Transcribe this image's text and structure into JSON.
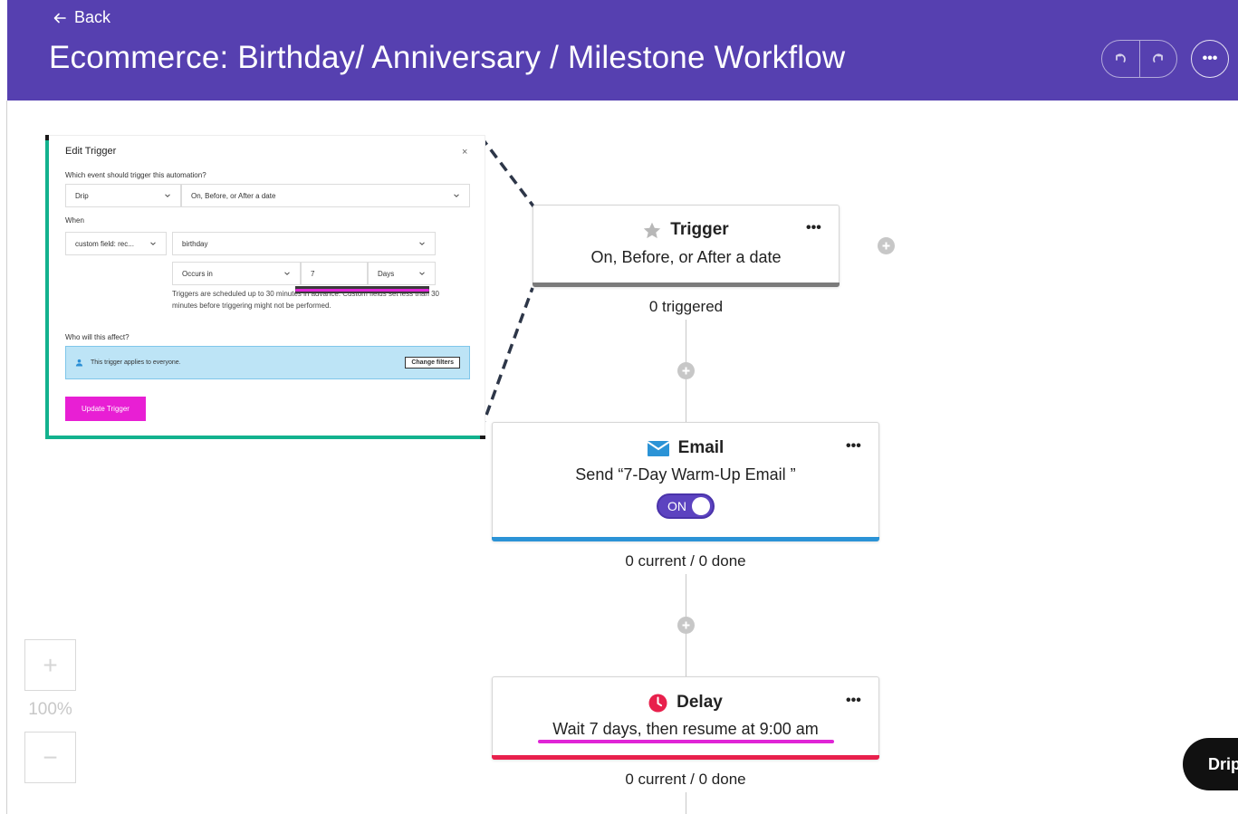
{
  "header": {
    "back_label": "Back",
    "title": "Ecommerce: Birthday/ Anniversary / Milestone Workflow",
    "more_label": "•••"
  },
  "edit_trigger": {
    "title": "Edit Trigger",
    "close": "×",
    "event_question": "Which event should trigger this automation?",
    "provider": "Drip",
    "event": "On, Before, or After a date",
    "when_label": "When",
    "field": "custom field: rec...",
    "field_value": "birthday",
    "timing": "Occurs in",
    "amount": "7",
    "unit": "Days",
    "note": "Triggers are scheduled up to 30 minutes in advance. Custom fields set less than 30 minutes before triggering might not be performed.",
    "affect_question": "Who will this affect?",
    "affect_text": "This trigger applies to everyone.",
    "change_filters": "Change filters",
    "update_button": "Update Trigger"
  },
  "flow": {
    "trigger": {
      "title": "Trigger",
      "subtitle": "On, Before, or After a date",
      "count": "0 triggered",
      "dots": "•••"
    },
    "email": {
      "title": "Email",
      "subtitle": "Send “7-Day Warm-Up Email ”",
      "toggle": "ON",
      "count": "0 current / 0 done",
      "dots": "•••"
    },
    "delay": {
      "title": "Delay",
      "subtitle": "Wait 7 days, then resume at 9:00 am",
      "count": "0 current / 0 done",
      "dots": "•••"
    }
  },
  "zoom": {
    "plus": "+",
    "level": "100%",
    "minus": "−"
  },
  "drip_button": "Drip",
  "colors": {
    "header_bg": "#5640b0",
    "accent_pink": "#e025d6",
    "email_bar": "#2b93d6",
    "delay_bar": "#e8204c",
    "trigger_bar": "#7a7a7a",
    "toggle_bg": "#5c43c0"
  },
  "icons": [
    "back-arrow-icon",
    "undo-icon",
    "redo-icon",
    "more-icon",
    "star-icon",
    "envelope-icon",
    "clock-icon",
    "plus-icon",
    "chevron-down-icon",
    "person-icon"
  ]
}
